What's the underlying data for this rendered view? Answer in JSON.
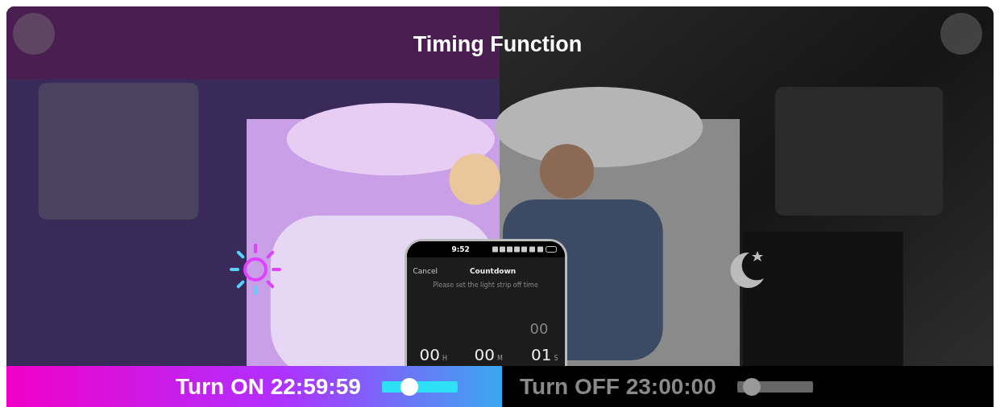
{
  "title": "Timing Function",
  "phone": {
    "time": "9:52",
    "cancel": "Cancel",
    "heading": "Countdown",
    "hint": "Please set the light strip off time",
    "picker": [
      {
        "value": "00",
        "unit": "H"
      },
      {
        "value": "00",
        "unit": "M"
      },
      {
        "value": "01",
        "unit": "S",
        "above": "00"
      }
    ]
  },
  "modes": [
    {
      "kind": "on",
      "label": "Turn ON 22:59:59",
      "level": 0.32
    },
    {
      "kind": "off",
      "label": "Turn OFF 23:00:00",
      "level": 0.1
    }
  ]
}
